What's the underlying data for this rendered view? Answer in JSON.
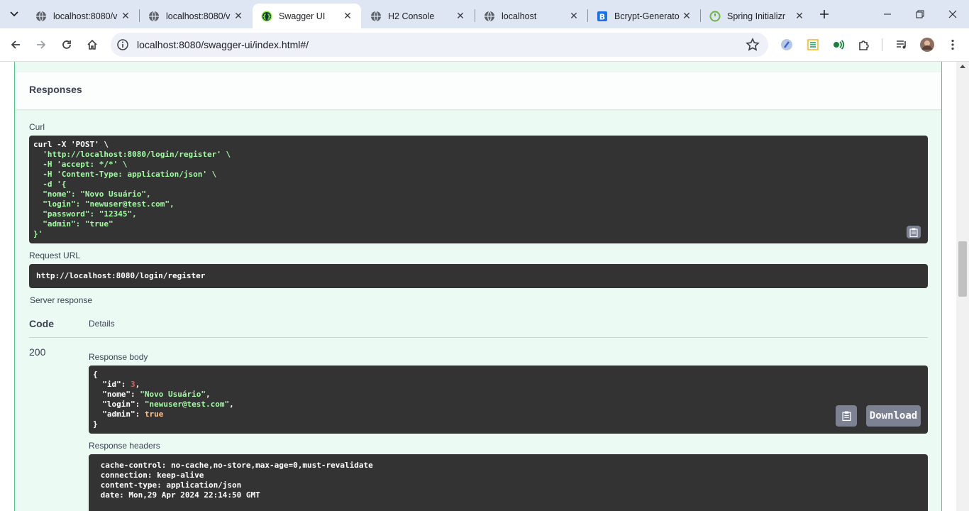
{
  "browser": {
    "tabs": [
      {
        "title": "localhost:8080/v",
        "icon": "globe-icon",
        "active": false
      },
      {
        "title": "localhost:8080/v",
        "icon": "globe-icon",
        "active": false
      },
      {
        "title": "Swagger UI",
        "icon": "swagger-icon",
        "active": true
      },
      {
        "title": "H2 Console",
        "icon": "globe-icon",
        "active": false
      },
      {
        "title": "localhost",
        "icon": "globe-icon",
        "active": false
      },
      {
        "title": "Bcrypt-Generato",
        "icon": "bcrypt-icon",
        "active": false
      },
      {
        "title": "Spring Initializr",
        "icon": "spring-icon",
        "active": false
      }
    ],
    "url": "localhost:8080/swagger-ui/index.html#/"
  },
  "responses": {
    "title": "Responses",
    "curl_label": "Curl",
    "curl_lines": [
      "curl -X 'POST' \\",
      "  'http://localhost:8080/login/register' \\",
      "  -H 'accept: */*' \\",
      "  -H 'Content-Type: application/json' \\",
      "  -d '{",
      "  \"nome\": \"Novo Usuário\",",
      "  \"login\": \"newuser@test.com\",",
      "  \"password\": \"12345\",",
      "  \"admin\": \"true\"",
      "}'"
    ],
    "request_url_label": "Request URL",
    "request_url": "http://localhost:8080/login/register",
    "server_response_label": "Server response",
    "code_header": "Code",
    "details_header": "Details",
    "status_code": "200",
    "response_body_label": "Response body",
    "response_body": {
      "open": "{",
      "id_key": "\"id\"",
      "id_val": "3",
      "nome_key": "\"nome\"",
      "nome_val": "\"Novo Usuário\"",
      "login_key": "\"login\"",
      "login_val": "\"newuser@test.com\"",
      "admin_key": "\"admin\"",
      "admin_val": "true",
      "close": "}"
    },
    "download_label": "Download",
    "response_headers_label": "Response headers",
    "response_headers": [
      " cache-control: no-cache,no-store,max-age=0,must-revalidate ",
      " connection: keep-alive ",
      " content-type: application/json ",
      " date: Mon,29 Apr 2024 22:14:50 GMT "
    ]
  }
}
